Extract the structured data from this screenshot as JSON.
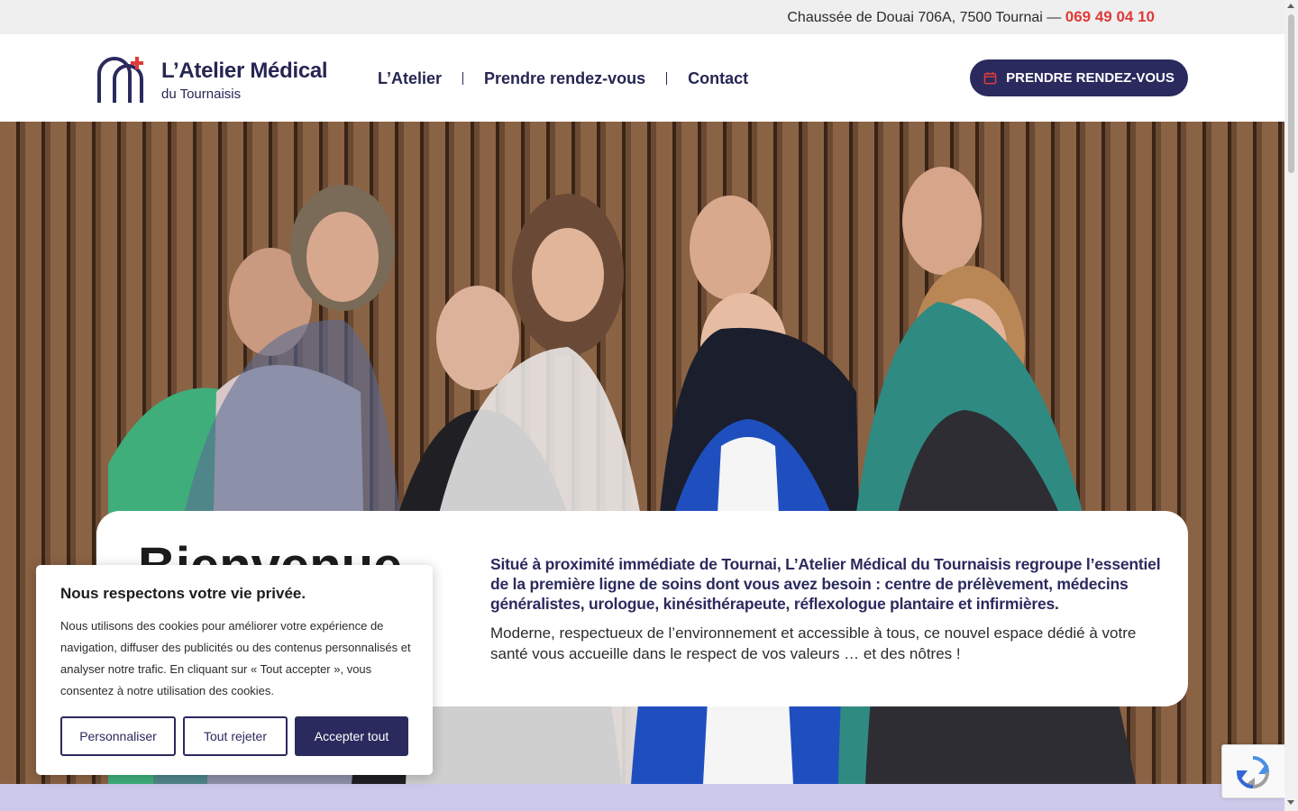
{
  "topbar": {
    "address": "Chaussée de Douai 706A, 7500 Tournai — ",
    "phone": "069 49 04 10"
  },
  "brand": {
    "title": "L’Atelier Médical",
    "subtitle": "du Tournaisis",
    "accent_color": "#e03a3a",
    "primary_color": "#2b2a5e"
  },
  "nav": {
    "items": [
      {
        "label": "L’Atelier"
      },
      {
        "label": "Prendre rendez-vous"
      },
      {
        "label": "Contact"
      }
    ]
  },
  "cta": {
    "label": "PRENDRE RENDEZ-VOUS",
    "icon": "calendar-icon"
  },
  "hero": {
    "image": "team-photo"
  },
  "welcome": {
    "title": "Bienvenue",
    "lead": "Situé à proximité immédiate de Tournai, L’Atelier Médical du Tournaisis regroupe l’essentiel de la première ligne de soins dont vous avez besoin : centre de prélèvement, médecins généralistes, urologue, kinésithérapeute, réflexologue plantaire et infirmières.",
    "body": "Moderne, respectueux de l’environnement et accessible à tous, ce nouvel espace dédié à votre santé vous accueille dans le respect de vos valeurs … et des nôtres !"
  },
  "cookie_banner": {
    "title": "Nous respectons votre vie privée.",
    "text": "Nous utilisons des cookies pour améliorer votre expérience de navigation, diffuser des publicités ou des contenus personnalisés et analyser notre trafic. En cliquant sur « Tout accepter », vous consentez à notre utilisation des cookies.",
    "customize_label": "Personnaliser",
    "reject_label": "Tout rejeter",
    "accept_label": "Accepter tout"
  },
  "widgets": {
    "recaptcha_icon": "recaptcha-icon"
  }
}
